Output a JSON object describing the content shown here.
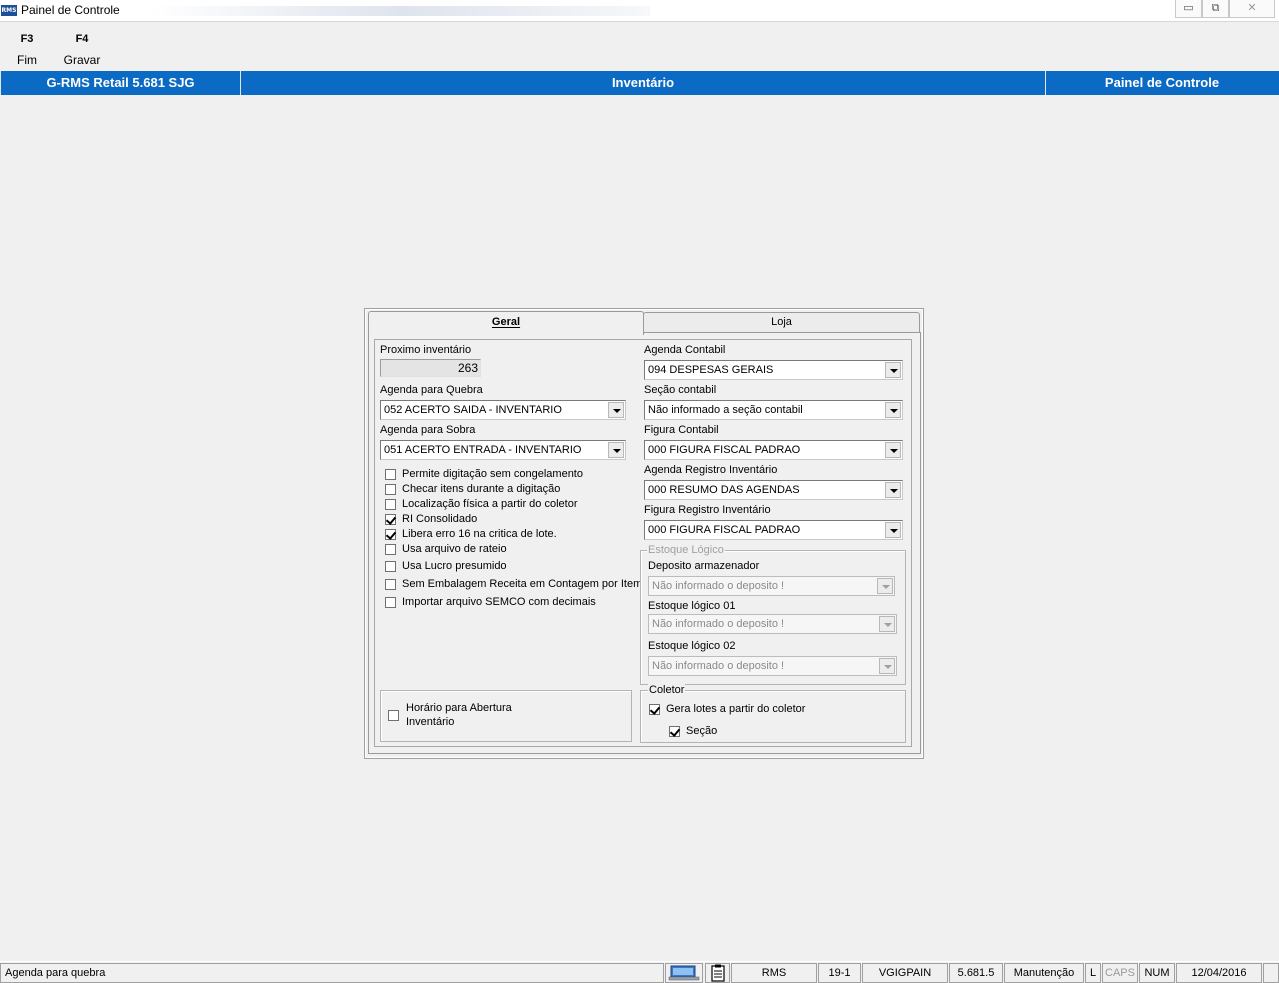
{
  "window": {
    "logo_text": "RMS",
    "title": "Painel de Controle",
    "controls": {
      "minimize": "▭",
      "restore": "⧉",
      "close": "✕"
    }
  },
  "toolbar": {
    "f3": {
      "key": "F3",
      "label": "Fim"
    },
    "f4": {
      "key": "F4",
      "label": "Gravar"
    }
  },
  "header": {
    "left": "G-RMS Retail 5.681 SJG",
    "center": "Inventário",
    "right": "Painel de Controle"
  },
  "tabs": [
    {
      "label": "Geral",
      "active": true
    },
    {
      "label": "Loja",
      "active": false
    }
  ],
  "form": {
    "proximo_inventario": {
      "label": "Proximo inventário",
      "value": "263"
    },
    "agenda_quebra": {
      "label": "Agenda para Quebra",
      "value": "052 ACERTO SAIDA - INVENTARIO"
    },
    "agenda_sobra": {
      "label": "Agenda para Sobra",
      "value": "051 ACERTO ENTRADA - INVENTARIO"
    },
    "checkboxes": [
      {
        "label": "Permite digitação sem congelamento",
        "checked": false
      },
      {
        "label": "Checar itens durante a digitação",
        "checked": false
      },
      {
        "label": "Localização física a partir do coletor",
        "checked": false
      },
      {
        "label": "RI Consolidado",
        "checked": true
      },
      {
        "label": "Libera erro 16 na critica de lote.",
        "checked": true
      },
      {
        "label": "Usa arquivo de rateio",
        "checked": false
      },
      {
        "label": "Usa Lucro presumido",
        "checked": false
      },
      {
        "label": "Sem Embalagem  Receita em Contagem por Item",
        "checked": false
      },
      {
        "label": "Importar arquivo SEMCO com decimais",
        "checked": false
      }
    ],
    "horario": {
      "label_line1": "Horário para Abertura",
      "label_line2": "Inventário",
      "checked": false
    },
    "agenda_contabil": {
      "label": "Agenda Contabil",
      "value": "094 DESPESAS GERAIS"
    },
    "secao_contabil": {
      "label": "Seção contabil",
      "value": "Não informado a seção contabil"
    },
    "figura_contabil": {
      "label": "Figura Contabil",
      "value": "000 FIGURA FISCAL PADRAO"
    },
    "agenda_registro": {
      "label": "Agenda Registro Inventário",
      "value": "000 RESUMO DAS AGENDAS"
    },
    "figura_registro": {
      "label": "Figura Registro Inventário",
      "value": "000 FIGURA FISCAL PADRAO"
    },
    "estoque_logico": {
      "legend": "Estoque Lógico",
      "deposito": {
        "label": "Deposito armazenador",
        "value": "Não informado o deposito !"
      },
      "estoque01": {
        "label": "Estoque lógico 01",
        "value": "Não informado o deposito !"
      },
      "estoque02": {
        "label": "Estoque lógico 02",
        "value": "Não informado o deposito !"
      }
    },
    "coletor": {
      "legend": "Coletor",
      "gera_lotes": {
        "label": "Gera lotes a partir do coletor",
        "checked": true
      },
      "secao": {
        "label": "Seção",
        "checked": true
      }
    }
  },
  "statusbar": {
    "message": "Agenda para quebra",
    "user": "RMS",
    "code": "19-1",
    "program": "VGIGPAIN",
    "version": "5.681.5",
    "mode": "Manutenção",
    "l": "L",
    "caps": "CAPS",
    "num": "NUM",
    "date": "12/04/2016"
  }
}
